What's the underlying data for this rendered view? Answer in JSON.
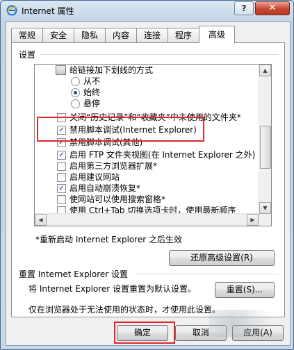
{
  "window": {
    "title": "Internet 属性",
    "help_label": "?",
    "close_label": "✕"
  },
  "tabs": [
    "常规",
    "安全",
    "隐私",
    "内容",
    "连接",
    "程序",
    "高级"
  ],
  "settings": {
    "group_label": "设置",
    "items": [
      {
        "type": "folder",
        "label": "给链接加下划线的方式"
      },
      {
        "type": "radio",
        "checked": false,
        "label": "从不"
      },
      {
        "type": "radio",
        "checked": true,
        "label": "始终"
      },
      {
        "type": "radio",
        "checked": false,
        "label": "悬停"
      },
      {
        "type": "checkbox",
        "checked": false,
        "label": "关闭“历史记录”和“收藏夹”中未使用的文件夹*"
      },
      {
        "type": "checkbox",
        "checked": true,
        "label": "禁用脚本调试(Internet Explorer)"
      },
      {
        "type": "checkbox",
        "checked": true,
        "label": "禁用脚本调试(其他)"
      },
      {
        "type": "checkbox",
        "checked": true,
        "label": "启用 FTP 文件夹视图(在 Internet Explorer 之外)"
      },
      {
        "type": "checkbox",
        "checked": false,
        "label": "启用第三方浏览器扩展*"
      },
      {
        "type": "checkbox",
        "checked": false,
        "label": "启用建议网站"
      },
      {
        "type": "checkbox",
        "checked": true,
        "label": "启用自动崩溃恢复*"
      },
      {
        "type": "checkbox",
        "checked": false,
        "label": "使网站可以使用搜索窗格*"
      },
      {
        "type": "checkbox",
        "checked": false,
        "label": "使用 Ctrl+Tab 切换选项卡时，使用最新顺序"
      }
    ],
    "note": "*重新启动 Internet Explorer 之后生效",
    "restore_button": "还原高级设置(R)"
  },
  "reset": {
    "title": "重置 Internet Explorer 设置",
    "desc": "将 Internet Explorer 设置重置为默认设置。",
    "button": "重置(S)...",
    "note": "仅在浏览器处于无法使用的状态时，才使用此设置。"
  },
  "footer": {
    "ok": "确定",
    "cancel": "取消",
    "apply": "应用(A)"
  },
  "icons": {
    "checkmark": "✓",
    "arrow_up": "▲",
    "arrow_down": "▼",
    "arrow_left": "◀",
    "arrow_right": "▶"
  },
  "colors": {
    "highlight_box": "#e0262b",
    "title_bar": "#c3d4e6",
    "close_button": "#c8462f"
  }
}
